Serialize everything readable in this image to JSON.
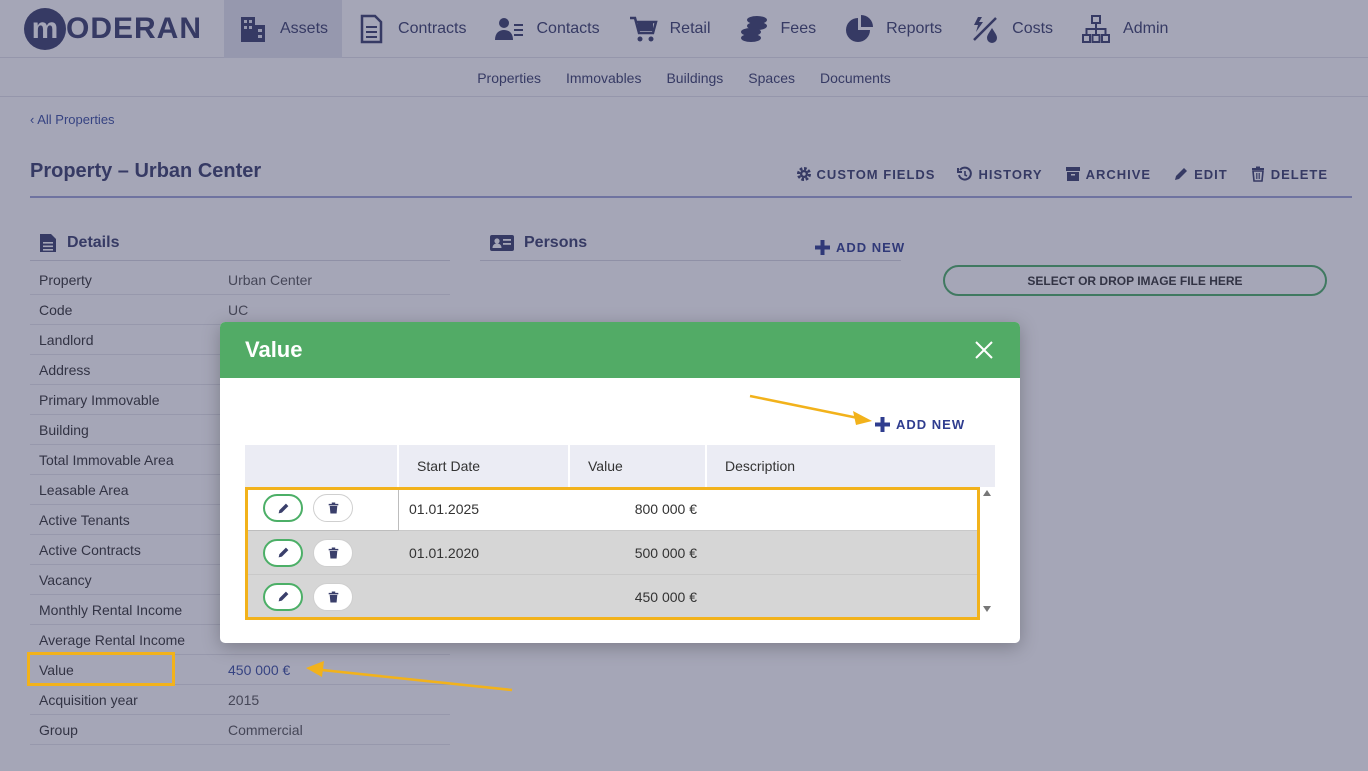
{
  "brand": {
    "logo_letter": "m",
    "logo_text": "ODERAN"
  },
  "nav": [
    {
      "label": "Assets",
      "icon": "building-icon"
    },
    {
      "label": "Contracts",
      "icon": "document-icon"
    },
    {
      "label": "Contacts",
      "icon": "contacts-icon"
    },
    {
      "label": "Retail",
      "icon": "cart-icon"
    },
    {
      "label": "Fees",
      "icon": "coins-icon"
    },
    {
      "label": "Reports",
      "icon": "pie-chart-icon"
    },
    {
      "label": "Costs",
      "icon": "costs-icon"
    },
    {
      "label": "Admin",
      "icon": "org-chart-icon"
    }
  ],
  "subnav": [
    "Properties",
    "Immovables",
    "Buildings",
    "Spaces",
    "Documents"
  ],
  "breadcrumb": "All Properties",
  "page_title": "Property – Urban Center",
  "actions": [
    "CUSTOM FIELDS",
    "HISTORY",
    "ARCHIVE",
    "EDIT",
    "DELETE"
  ],
  "details": {
    "heading": "Details",
    "rows": [
      {
        "label": "Property",
        "value": "Urban Center"
      },
      {
        "label": "Code",
        "value": "UC"
      },
      {
        "label": "Landlord",
        "value": ""
      },
      {
        "label": "Address",
        "value": ""
      },
      {
        "label": "Primary Immovable",
        "value": ""
      },
      {
        "label": "Building",
        "value": ""
      },
      {
        "label": "Total Immovable Area",
        "value": ""
      },
      {
        "label": "Leasable Area",
        "value": ""
      },
      {
        "label": "Active Tenants",
        "value": ""
      },
      {
        "label": "Active Contracts",
        "value": ""
      },
      {
        "label": "Vacancy",
        "value": ""
      },
      {
        "label": "Monthly Rental Income",
        "value": ""
      },
      {
        "label": "Average Rental Income",
        "value": ""
      },
      {
        "label": "Value",
        "value": "450 000 €"
      },
      {
        "label": "Acquisition year",
        "value": "2015"
      },
      {
        "label": "Group",
        "value": "Commercial"
      }
    ]
  },
  "persons": {
    "heading": "Persons",
    "add_new": "ADD NEW"
  },
  "drop_zone": "SELECT OR DROP IMAGE FILE HERE",
  "modal": {
    "title": "Value",
    "add_new": "ADD NEW",
    "columns": [
      "",
      "Start Date",
      "Value",
      "Description"
    ],
    "rows": [
      {
        "start_date": "01.01.2025",
        "value": "800 000 €",
        "description": ""
      },
      {
        "start_date": "01.01.2020",
        "value": "500 000 €",
        "description": ""
      },
      {
        "start_date": "",
        "value": "450 000 €",
        "description": ""
      }
    ]
  },
  "colors": {
    "accent_green": "#52ab66",
    "brand_navy": "#3a3f6b",
    "highlight": "#f2b21b",
    "link_blue": "#3a4fa0"
  }
}
